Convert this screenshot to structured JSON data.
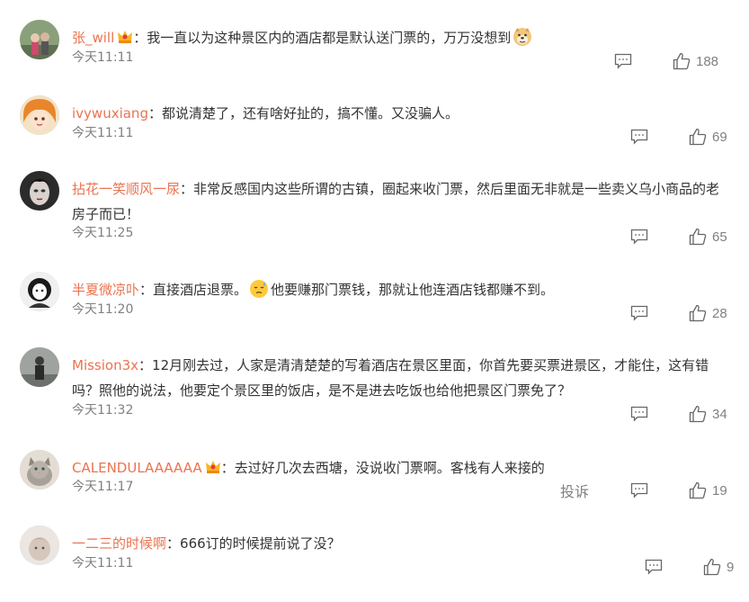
{
  "comments": [
    {
      "user": "张_will",
      "vip": true,
      "sep": "：",
      "text_before": "我一直以为这种景区内的酒店都是默认送门票的，万万没想到",
      "emoji": "doge",
      "text_after": "",
      "time": "今天11:11",
      "likes": "188"
    },
    {
      "user": "ivywuxiang",
      "vip": false,
      "sep": "：",
      "text_before": "都说清楚了，还有啥好扯的，搞不懂。又没骗人。",
      "time": "今天11:11",
      "likes": "69"
    },
    {
      "user": "拈花一笑顺风一尿",
      "vip": false,
      "sep": "：",
      "text_before": "非常反感国内这些所谓的古镇，圈起来收门票，然后里面无非就是一些卖义乌小商品的老房子而已！",
      "time": "今天11:25",
      "likes": "65"
    },
    {
      "user": "半夏微凉卟",
      "vip": false,
      "sep": "：",
      "text_before": "直接酒店退票。",
      "emoji": "sweat",
      "text_after": "他要赚那门票钱，那就让他连酒店钱都赚不到。",
      "time": "今天11:20",
      "likes": "28"
    },
    {
      "user": "Mission3x",
      "vip": false,
      "sep": "：",
      "text_before": "12月刚去过，人家是清清楚楚的写着酒店在景区里面，你首先要买票进景区，才能住，这有错吗？照他的说法，他要定个景区里的饭店，是不是进去吃饭也给他把景区门票免了？",
      "time": "今天11:32",
      "likes": "34"
    },
    {
      "user": "CALENDULAAAAAA",
      "vip": true,
      "sep": "：",
      "text_before": "去过好几次去西塘，没说收门票啊。客栈有人来接的",
      "time": "今天11:17",
      "likes": "19",
      "report": "投诉"
    },
    {
      "user": "一二三的时候啊",
      "vip": false,
      "sep": "：",
      "text_before": "666订的时候提前说了没？",
      "time": "今天11:11",
      "likes": "9"
    }
  ],
  "colors": {
    "username": "#eb7350",
    "meta": "#808080",
    "text": "#333333"
  }
}
